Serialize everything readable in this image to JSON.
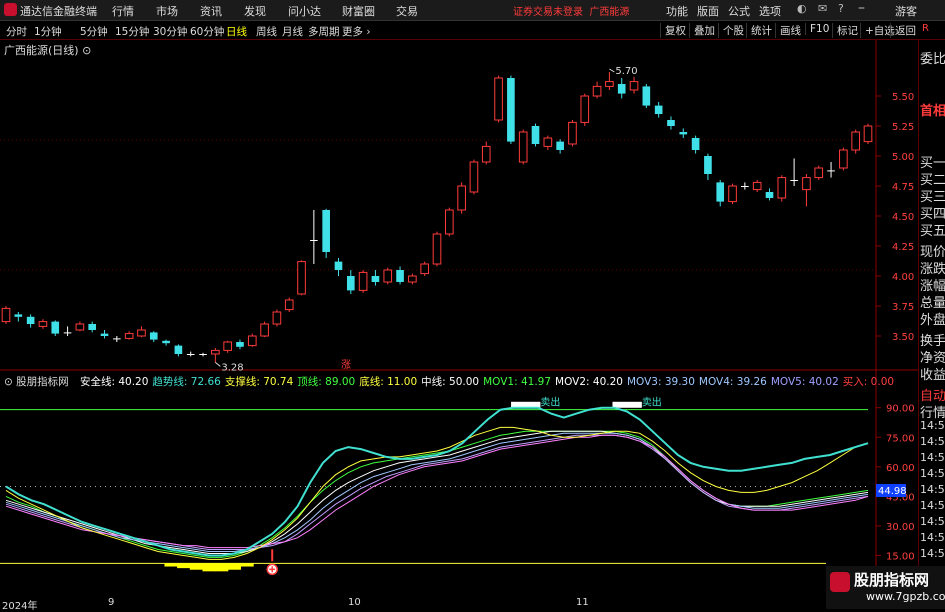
{
  "app": {
    "title": "通达信金融终端",
    "menu": [
      "行情",
      "市场",
      "资讯",
      "发现",
      "问小达",
      "财富圈",
      "交易"
    ],
    "warning": "证券交易未登录",
    "stock_name_top": "广西能源",
    "right_menu": [
      "功能",
      "版面",
      "公式",
      "选项"
    ],
    "guest": "游客"
  },
  "periods": {
    "items": [
      "分时",
      "1分钟",
      "5分钟",
      "15分钟",
      "30分钟",
      "60分钟",
      "日线",
      "周线",
      "月线",
      "多周期",
      "更多"
    ],
    "active": "日线"
  },
  "toolbar": [
    "复权",
    "叠加",
    "个股",
    "统计",
    "画线",
    "F10",
    "标记",
    "+自选",
    "返回"
  ],
  "chart_title": "广西能源(日线)",
  "right_panel": {
    "labels": [
      "委比",
      "首相",
      "买一",
      "买二",
      "买三",
      "买四",
      "买五",
      "现价",
      "涨跌",
      "涨幅",
      "总量",
      "外盘",
      "换手",
      "净资",
      "收益",
      "自动",
      "行情"
    ],
    "r_badge": "R"
  },
  "indicator": {
    "name": "股朋指标网",
    "values": [
      {
        "label": "安全线:",
        "value": "40.20",
        "color": "#ffffff"
      },
      {
        "label": "趋势线:",
        "value": "72.66",
        "color": "#40e0d0"
      },
      {
        "label": "支撑线:",
        "value": "70.74",
        "color": "#ffff40"
      },
      {
        "label": "顶线:",
        "value": "89.00",
        "color": "#40ff40"
      },
      {
        "label": "底线:",
        "value": "11.00",
        "color": "#ffff40"
      },
      {
        "label": "中线:",
        "value": "50.00",
        "color": "#ffffff"
      },
      {
        "label": "MOV1:",
        "value": "41.97",
        "color": "#40ff40"
      },
      {
        "label": "MOV2:",
        "value": "40.20",
        "color": "#ffffff"
      },
      {
        "label": "MOV3:",
        "value": "39.30",
        "color": "#a0c8ff"
      },
      {
        "label": "MOV4:",
        "value": "39.26",
        "color": "#a0c8ff"
      },
      {
        "label": "MOV5:",
        "value": "40.02",
        "color": "#a0a0ff"
      },
      {
        "label": "买入:",
        "value": "0.00",
        "color": "#ff4040"
      }
    ],
    "sell_label": "卖出",
    "current_value": "44.98"
  },
  "annotations": {
    "high": "5.70",
    "low": "3.28",
    "zhang": "涨"
  },
  "dates": [
    "2024年",
    "9",
    "10",
    "11"
  ],
  "watermark": {
    "line1": "股朋指标网",
    "line2": "www.7gpzb.com"
  },
  "chart_data": {
    "type": "candlestick",
    "title": "广西能源(日线)",
    "price_ticks": [
      5.5,
      5.25,
      5.0,
      4.75,
      4.5,
      4.25,
      4.0,
      3.75,
      3.5
    ],
    "osc_ticks": [
      90.0,
      75.0,
      60.0,
      45.0,
      30.0,
      15.0
    ],
    "high_label": 5.7,
    "low_label": 3.28,
    "candles": [
      {
        "o": 3.62,
        "c": 3.73,
        "h": 3.75,
        "l": 3.6
      },
      {
        "o": 3.68,
        "c": 3.66,
        "h": 3.7,
        "l": 3.62
      },
      {
        "o": 3.66,
        "c": 3.6,
        "h": 3.68,
        "l": 3.57
      },
      {
        "o": 3.58,
        "c": 3.62,
        "h": 3.64,
        "l": 3.56
      },
      {
        "o": 3.62,
        "c": 3.52,
        "h": 3.63,
        "l": 3.5
      },
      {
        "o": 3.53,
        "c": 3.53,
        "h": 3.58,
        "l": 3.5
      },
      {
        "o": 3.55,
        "c": 3.6,
        "h": 3.62,
        "l": 3.54
      },
      {
        "o": 3.6,
        "c": 3.55,
        "h": 3.62,
        "l": 3.53
      },
      {
        "o": 3.52,
        "c": 3.5,
        "h": 3.55,
        "l": 3.48
      },
      {
        "o": 3.48,
        "c": 3.48,
        "h": 3.5,
        "l": 3.45
      },
      {
        "o": 3.48,
        "c": 3.52,
        "h": 3.54,
        "l": 3.47
      },
      {
        "o": 3.5,
        "c": 3.55,
        "h": 3.58,
        "l": 3.49
      },
      {
        "o": 3.53,
        "c": 3.47,
        "h": 3.54,
        "l": 3.45
      },
      {
        "o": 3.46,
        "c": 3.44,
        "h": 3.47,
        "l": 3.42
      },
      {
        "o": 3.42,
        "c": 3.35,
        "h": 3.43,
        "l": 3.33
      },
      {
        "o": 3.35,
        "c": 3.35,
        "h": 3.37,
        "l": 3.33
      },
      {
        "o": 3.35,
        "c": 3.35,
        "h": 3.36,
        "l": 3.33
      },
      {
        "o": 3.35,
        "c": 3.38,
        "h": 3.4,
        "l": 3.28
      },
      {
        "o": 3.38,
        "c": 3.45,
        "h": 3.46,
        "l": 3.36
      },
      {
        "o": 3.45,
        "c": 3.41,
        "h": 3.47,
        "l": 3.39
      },
      {
        "o": 3.42,
        "c": 3.5,
        "h": 3.52,
        "l": 3.41
      },
      {
        "o": 3.5,
        "c": 3.6,
        "h": 3.62,
        "l": 3.49
      },
      {
        "o": 3.6,
        "c": 3.7,
        "h": 3.72,
        "l": 3.58
      },
      {
        "o": 3.72,
        "c": 3.8,
        "h": 3.82,
        "l": 3.7
      },
      {
        "o": 3.85,
        "c": 4.12,
        "h": 4.13,
        "l": 3.84
      },
      {
        "o": 4.3,
        "c": 4.3,
        "h": 4.55,
        "l": 4.1
      },
      {
        "o": 4.55,
        "c": 4.2,
        "h": 4.56,
        "l": 4.15
      },
      {
        "o": 4.12,
        "c": 4.05,
        "h": 4.15,
        "l": 4.0
      },
      {
        "o": 4.0,
        "c": 3.88,
        "h": 4.05,
        "l": 3.85
      },
      {
        "o": 3.88,
        "c": 4.03,
        "h": 4.05,
        "l": 3.86
      },
      {
        "o": 4.0,
        "c": 3.95,
        "h": 4.05,
        "l": 3.92
      },
      {
        "o": 3.95,
        "c": 4.05,
        "h": 4.07,
        "l": 3.93
      },
      {
        "o": 4.05,
        "c": 3.95,
        "h": 4.08,
        "l": 3.93
      },
      {
        "o": 3.95,
        "c": 4.0,
        "h": 4.02,
        "l": 3.93
      },
      {
        "o": 4.02,
        "c": 4.1,
        "h": 4.12,
        "l": 4.0
      },
      {
        "o": 4.1,
        "c": 4.35,
        "h": 4.37,
        "l": 4.08
      },
      {
        "o": 4.35,
        "c": 4.55,
        "h": 4.57,
        "l": 4.33
      },
      {
        "o": 4.55,
        "c": 4.75,
        "h": 4.78,
        "l": 4.52
      },
      {
        "o": 4.7,
        "c": 4.95,
        "h": 4.97,
        "l": 4.68
      },
      {
        "o": 4.95,
        "c": 5.08,
        "h": 5.12,
        "l": 4.93
      },
      {
        "o": 5.3,
        "c": 5.65,
        "h": 5.67,
        "l": 5.28
      },
      {
        "o": 5.65,
        "c": 5.12,
        "h": 5.67,
        "l": 5.1
      },
      {
        "o": 4.95,
        "c": 5.2,
        "h": 5.22,
        "l": 4.93
      },
      {
        "o": 5.25,
        "c": 5.1,
        "h": 5.27,
        "l": 5.08
      },
      {
        "o": 5.08,
        "c": 5.15,
        "h": 5.17,
        "l": 5.05
      },
      {
        "o": 5.12,
        "c": 5.05,
        "h": 5.14,
        "l": 5.02
      },
      {
        "o": 5.1,
        "c": 5.28,
        "h": 5.3,
        "l": 5.08
      },
      {
        "o": 5.28,
        "c": 5.5,
        "h": 5.52,
        "l": 5.25
      },
      {
        "o": 5.5,
        "c": 5.58,
        "h": 5.62,
        "l": 5.48
      },
      {
        "o": 5.58,
        "c": 5.62,
        "h": 5.7,
        "l": 5.55
      },
      {
        "o": 5.6,
        "c": 5.52,
        "h": 5.65,
        "l": 5.48
      },
      {
        "o": 5.55,
        "c": 5.62,
        "h": 5.66,
        "l": 5.52
      },
      {
        "o": 5.58,
        "c": 5.42,
        "h": 5.6,
        "l": 5.4
      },
      {
        "o": 5.42,
        "c": 5.35,
        "h": 5.45,
        "l": 5.32
      },
      {
        "o": 5.3,
        "c": 5.25,
        "h": 5.33,
        "l": 5.22
      },
      {
        "o": 5.2,
        "c": 5.18,
        "h": 5.23,
        "l": 5.15
      },
      {
        "o": 5.15,
        "c": 5.05,
        "h": 5.17,
        "l": 5.02
      },
      {
        "o": 5.0,
        "c": 4.85,
        "h": 5.02,
        "l": 4.8
      },
      {
        "o": 4.78,
        "c": 4.62,
        "h": 4.8,
        "l": 4.58
      },
      {
        "o": 4.62,
        "c": 4.75,
        "h": 4.77,
        "l": 4.6
      },
      {
        "o": 4.75,
        "c": 4.75,
        "h": 4.78,
        "l": 4.72
      },
      {
        "o": 4.72,
        "c": 4.78,
        "h": 4.8,
        "l": 4.7
      },
      {
        "o": 4.7,
        "c": 4.65,
        "h": 4.73,
        "l": 4.63
      },
      {
        "o": 4.65,
        "c": 4.82,
        "h": 4.84,
        "l": 4.62
      },
      {
        "o": 4.8,
        "c": 4.8,
        "h": 4.98,
        "l": 4.75
      },
      {
        "o": 4.72,
        "c": 4.82,
        "h": 4.85,
        "l": 4.58
      },
      {
        "o": 4.82,
        "c": 4.9,
        "h": 4.92,
        "l": 4.8
      },
      {
        "o": 4.88,
        "c": 4.88,
        "h": 4.95,
        "l": 4.82
      },
      {
        "o": 4.9,
        "c": 5.05,
        "h": 5.07,
        "l": 4.88
      },
      {
        "o": 5.05,
        "c": 5.2,
        "h": 5.22,
        "l": 5.02
      },
      {
        "o": 5.12,
        "c": 5.25,
        "h": 5.27,
        "l": 5.1
      }
    ],
    "osc_trend": [
      50,
      46,
      43,
      41,
      38,
      35,
      32,
      30,
      28,
      26,
      24,
      22,
      20,
      18,
      17,
      16,
      15,
      15,
      16,
      18,
      22,
      26,
      32,
      40,
      52,
      62,
      68,
      70,
      69,
      67,
      65,
      64,
      64,
      65,
      66,
      68,
      72,
      78,
      84,
      89,
      90,
      90,
      90,
      87,
      85,
      87,
      89,
      90,
      90,
      88,
      84,
      78,
      72,
      66,
      62,
      60,
      59,
      58,
      58,
      59,
      60,
      61,
      62,
      64,
      65,
      66,
      68,
      70,
      72
    ],
    "osc_support": [
      48,
      44,
      41,
      38,
      35,
      32,
      29,
      27,
      25,
      23,
      21,
      19,
      17,
      16,
      15,
      14,
      13,
      13,
      14,
      16,
      19,
      23,
      28,
      34,
      42,
      50,
      56,
      60,
      63,
      64,
      65,
      65,
      66,
      67,
      68,
      70,
      73,
      76,
      78,
      80,
      80,
      79,
      78,
      76,
      75,
      75,
      76,
      77,
      78,
      78,
      77,
      73,
      68,
      62,
      57,
      53,
      50,
      48,
      47,
      47,
      48,
      50,
      52,
      55,
      58,
      62,
      66,
      70,
      72
    ],
    "mov_lines": [
      [
        45,
        42,
        40,
        37,
        35,
        32,
        30,
        28,
        26,
        24,
        22,
        20,
        18,
        17,
        16,
        15,
        14,
        14,
        15,
        17,
        20,
        24,
        29,
        35,
        42,
        48,
        53,
        57,
        60,
        62,
        63,
        64,
        65,
        66,
        67,
        68,
        70,
        72,
        74,
        76,
        77,
        78,
        78,
        78,
        78,
        78,
        78,
        78,
        78,
        77,
        75,
        71,
        65,
        58,
        52,
        47,
        43,
        41,
        40,
        40,
        40,
        41,
        42,
        43,
        44,
        45,
        46,
        47,
        48
      ],
      [
        43,
        41,
        39,
        37,
        35,
        33,
        31,
        29,
        27,
        25,
        23,
        21,
        20,
        19,
        18,
        17,
        16,
        16,
        16,
        17,
        19,
        22,
        26,
        31,
        37,
        43,
        48,
        52,
        55,
        58,
        60,
        62,
        63,
        64,
        65,
        66,
        68,
        70,
        72,
        74,
        75,
        76,
        77,
        78,
        78,
        78,
        78,
        78,
        77,
        76,
        74,
        70,
        64,
        58,
        52,
        47,
        43,
        41,
        40,
        40,
        40,
        40,
        41,
        42,
        43,
        44,
        45,
        46,
        47
      ],
      [
        42,
        40,
        38,
        36,
        34,
        32,
        30,
        28,
        26,
        24,
        23,
        22,
        21,
        20,
        19,
        18,
        17,
        17,
        17,
        18,
        19,
        21,
        24,
        28,
        33,
        39,
        44,
        48,
        52,
        55,
        57,
        59,
        61,
        62,
        63,
        64,
        66,
        68,
        70,
        72,
        73,
        74,
        75,
        76,
        77,
        77,
        77,
        77,
        77,
        76,
        74,
        70,
        65,
        59,
        53,
        48,
        44,
        41,
        40,
        39,
        39,
        39,
        40,
        41,
        42,
        43,
        44,
        45,
        46
      ],
      [
        41,
        39,
        37,
        35,
        33,
        31,
        29,
        27,
        26,
        25,
        24,
        23,
        22,
        21,
        20,
        19,
        18,
        18,
        18,
        18,
        19,
        20,
        22,
        26,
        31,
        36,
        41,
        45,
        49,
        52,
        55,
        57,
        59,
        61,
        62,
        63,
        64,
        66,
        68,
        70,
        71,
        72,
        73,
        74,
        75,
        76,
        76,
        76,
        76,
        75,
        73,
        69,
        64,
        58,
        52,
        47,
        43,
        40,
        39,
        38,
        38,
        38,
        39,
        40,
        41,
        42,
        43,
        44,
        45
      ],
      [
        40,
        38,
        36,
        34,
        32,
        30,
        28,
        27,
        26,
        25,
        24,
        23,
        22,
        21,
        20,
        20,
        19,
        19,
        19,
        19,
        20,
        21,
        22,
        24,
        28,
        33,
        38,
        42,
        46,
        50,
        53,
        56,
        58,
        60,
        61,
        62,
        63,
        65,
        67,
        69,
        70,
        71,
        72,
        73,
        74,
        75,
        75,
        76,
        76,
        75,
        73,
        70,
        65,
        59,
        53,
        48,
        44,
        41,
        39,
        38,
        38,
        38,
        38,
        39,
        40,
        41,
        42,
        43,
        45
      ]
    ],
    "osc_ylim": [
      0,
      100
    ],
    "price_ylim": [
      3.3,
      5.8
    ]
  }
}
